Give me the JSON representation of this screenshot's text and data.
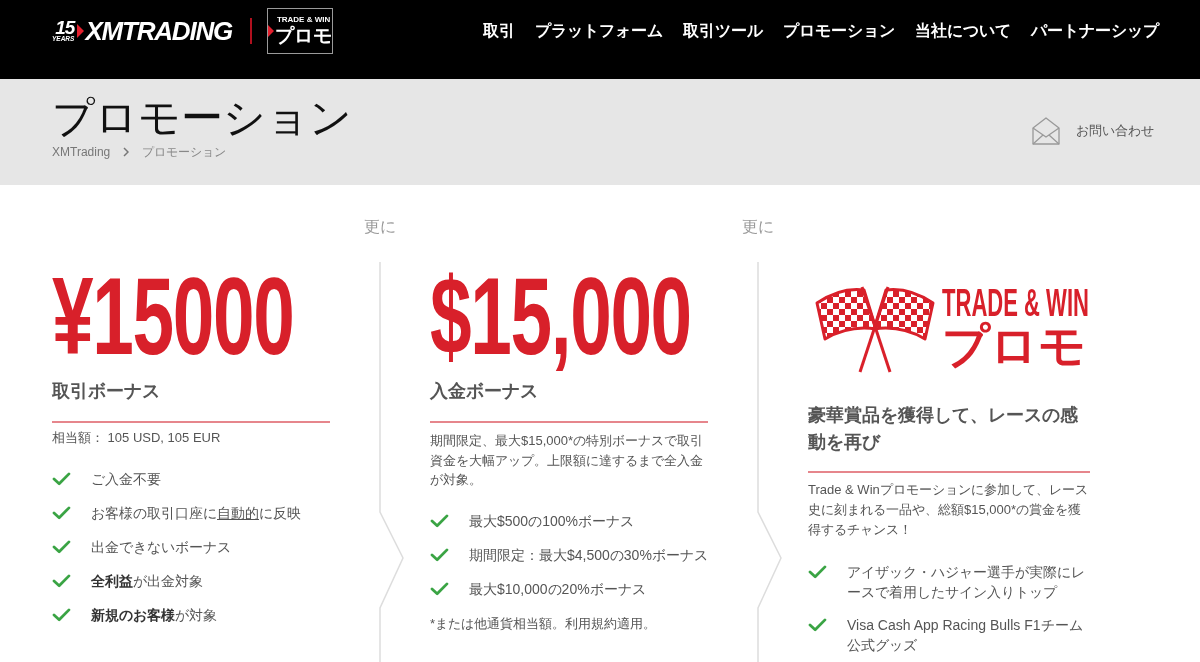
{
  "header": {
    "logo": {
      "years": "15",
      "years_label": "YEARS",
      "name": "XMTRADING"
    },
    "promo_badge": {
      "tagline": "TRADE & WIN",
      "label": "プロモ"
    },
    "nav": [
      "取引",
      "プラットフォーム",
      "取引ツール",
      "プロモーション",
      "当社について",
      "パートナーシップ"
    ]
  },
  "page_header": {
    "title": "プロモーション",
    "breadcrumb": [
      "XMTrading",
      "プロモーション"
    ],
    "contact_link": "お問い合わせ"
  },
  "connectors": [
    "更に",
    "更に"
  ],
  "offers": [
    {
      "kind": "amount",
      "amount": "¥15000",
      "title": "取引ボーナス",
      "note": "相当額： 105 USD, 105 EUR",
      "features": [
        {
          "text": "ご入金不要"
        },
        {
          "text": "お客様の取引口座に",
          "link": "自動的",
          "text_after": "に反映"
        },
        {
          "text": "出金できないボーナス"
        },
        {
          "text": "**全利益**が出金対象"
        },
        {
          "text": "**新規のお客様**が対象"
        }
      ]
    },
    {
      "kind": "amount",
      "amount": "$15,000",
      "title": "入金ボーナス",
      "description": "期間限定、最大$15,000*の特別ボーナスで取引資金を大幅アップ。上限額に達するまで全入金が対象。",
      "features": [
        {
          "text": "最大$500の100%ボーナス"
        },
        {
          "text": "期間限定：最大$4,500の30%ボーナス"
        },
        {
          "text": "最大$10,000の20%ボーナス"
        }
      ],
      "footnote": "*または他通貨相当額。利用規約適用。"
    },
    {
      "kind": "logo",
      "logo": {
        "tagline": "TRADE & WIN",
        "label": "プロモ"
      },
      "title": "豪華賞品を獲得して、レースの感動を再び",
      "description": "Trade & Winプロモーションに参加して、レース史に刻まれる一品や、総額$15,000*の賞金を獲得するチャンス！",
      "features": [
        {
          "text": "アイザック・ハジャー選手が実際にレースで着用したサイン入りトップ"
        },
        {
          "text": "Visa Cash App Racing Bulls F1チーム公式グッズ"
        }
      ]
    }
  ]
}
